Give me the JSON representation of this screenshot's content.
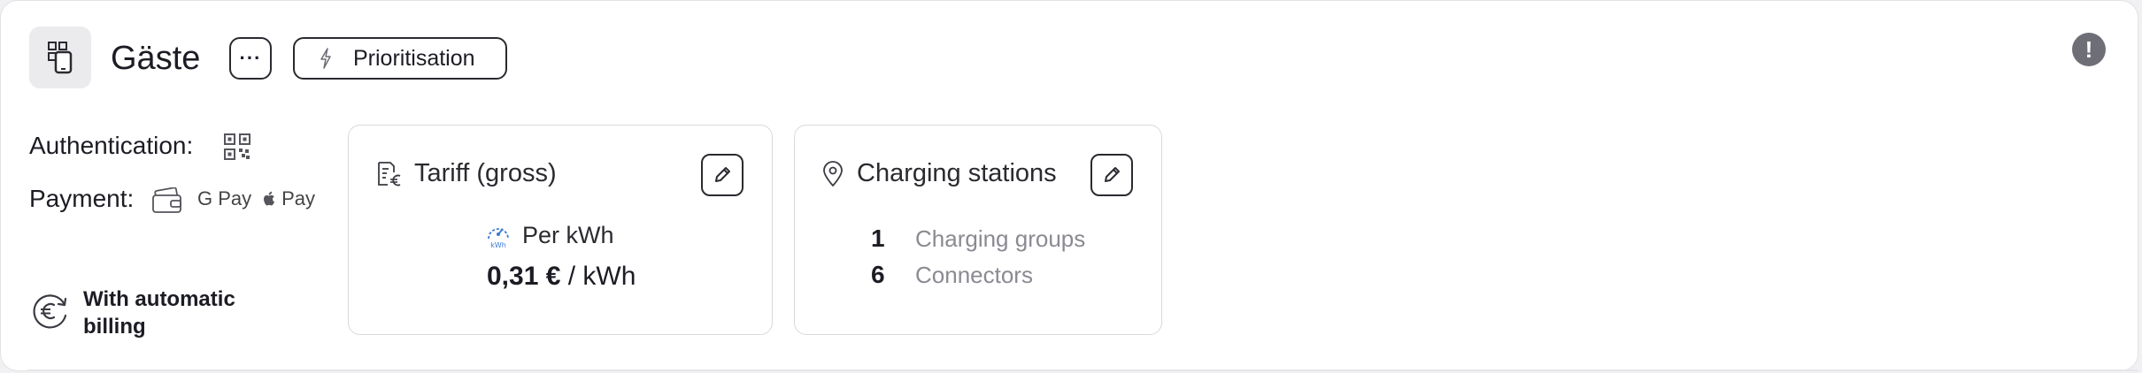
{
  "header": {
    "title": "Gäste",
    "more_label": "···",
    "prioritisation_label": "Prioritisation",
    "alert_label": "!"
  },
  "details": {
    "authentication_label": "Authentication:",
    "payment_label": "Payment:",
    "payment_methods": [
      "card-wallet-icon",
      "G Pay",
      " Pay"
    ],
    "gpay_label": "G Pay",
    "applepay_label": "Pay",
    "billing_label": "With automatic billing"
  },
  "tariff": {
    "title": "Tariff (gross)",
    "mode_label": "Per kWh",
    "price_value": "0,31 €",
    "price_unit": "/ kWh"
  },
  "stations": {
    "title": "Charging stations",
    "rows": [
      {
        "count": "1",
        "label": "Charging groups"
      },
      {
        "count": "6",
        "label": "Connectors"
      }
    ]
  },
  "colors": {
    "accent_blue": "#3a7bd5",
    "text": "#1c1c24",
    "muted": "#8a8a92",
    "alert": "#6e6e76"
  }
}
